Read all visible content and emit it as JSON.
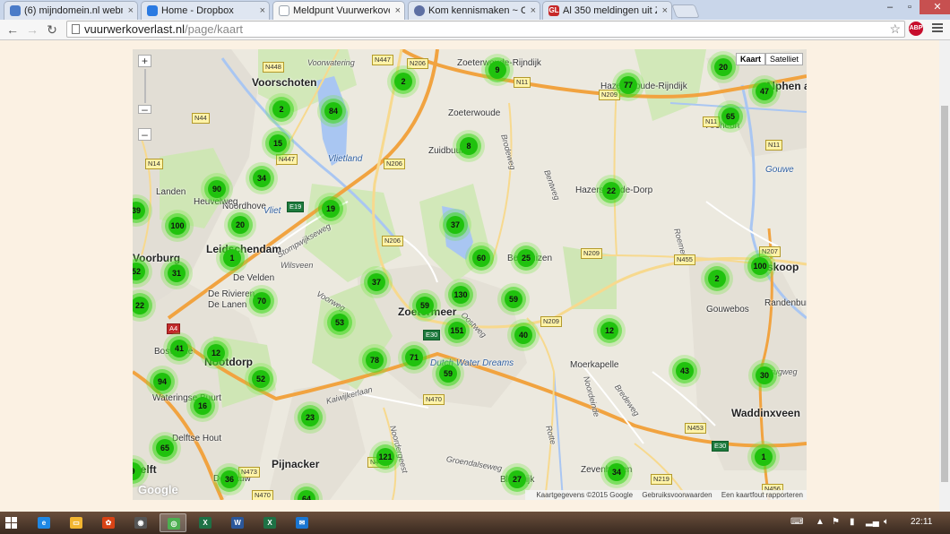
{
  "browser": {
    "tabs": [
      {
        "label": "(6) mijndomein.nl webma",
        "icon": "webmail-icon",
        "color": "#4a7bc8"
      },
      {
        "label": "Home - Dropbox",
        "icon": "dropbox-icon",
        "color": "#2a7ae2"
      },
      {
        "label": "Meldpunt Vuurwerkoverla",
        "icon": "page-icon",
        "color": "#9aa3ad",
        "active": true
      },
      {
        "label": "Kom kennismaken ~ Cont",
        "icon": "globe-icon",
        "color": "#5d6fa3"
      },
      {
        "label": "Al 350 meldingen uit Zoet",
        "icon": "gl-icon",
        "color": "#c62828"
      }
    ],
    "close_label": "×",
    "url_host": "vuurwerkoverlast.nl",
    "url_path": "/page/kaart",
    "abp_label": "ABP",
    "window_controls": [
      "–",
      "▫",
      "✕"
    ]
  },
  "map": {
    "zoom_in": "+",
    "zoom_out": "–",
    "zoom_out2": "–",
    "map_types": [
      "Kaart",
      "Satelliet"
    ],
    "google_logo": "Google",
    "attribution": [
      "Kaartgegevens ©2015 Google",
      "Gebruiksvoorwaarden",
      "Een kaartfout rapporteren"
    ],
    "places": [
      {
        "name": "Voorschoten",
        "big": true
      },
      {
        "name": "Leidschendam",
        "big": true
      },
      {
        "name": "Voorburg",
        "big": true
      },
      {
        "name": "Zoetermeer",
        "big": true
      },
      {
        "name": "Nootdorp",
        "big": true
      },
      {
        "name": "Pijnacker",
        "big": true
      },
      {
        "name": "Delft",
        "big": true
      },
      {
        "name": "Zoeterwoude",
        "big": false
      },
      {
        "name": "Zoeterwoude-Rijndijk",
        "big": false
      },
      {
        "name": "Zuidbuurt",
        "big": false
      },
      {
        "name": "Hazerswoude-Rijndijk",
        "big": false
      },
      {
        "name": "Hazerswoude-Dorp",
        "big": false
      },
      {
        "name": "Benthuizen",
        "big": false
      },
      {
        "name": "Moerkapelle",
        "big": false
      },
      {
        "name": "Waddinxveen",
        "big": true
      },
      {
        "name": "Randenburg",
        "big": false
      },
      {
        "name": "Boskoop",
        "big": true
      },
      {
        "name": "Gouwebos",
        "big": false
      },
      {
        "name": "Alphen aan den Rijn",
        "big": true
      },
      {
        "name": "Archeon",
        "big": false
      },
      {
        "name": "Zevenhuizen",
        "big": false
      },
      {
        "name": "Bleiswijk",
        "big": false
      },
      {
        "name": "Delfgauw",
        "big": false
      },
      {
        "name": "Landen",
        "big": false
      },
      {
        "name": "De Velden",
        "big": false
      },
      {
        "name": "De Rivieren",
        "big": false
      },
      {
        "name": "De Lanen",
        "big": false
      },
      {
        "name": "Bosweide",
        "big": false
      },
      {
        "name": "Wateringse Buurt",
        "big": false
      },
      {
        "name": "Delftse Hout",
        "big": false
      },
      {
        "name": "Noordhove",
        "big": false
      },
      {
        "name": "Heuvelweg",
        "big": false
      }
    ],
    "water_labels": [
      "Vlietland",
      "Vliet",
      "Dutch Water Dreams",
      "Gouwe"
    ],
    "road_labels": [
      "Voorwatering",
      "Stompwijkseweg",
      "Wilsveen",
      "Voorweg",
      "Oostweg",
      "Kaiwijkerlaan",
      "Bentweg",
      "Brodeweg",
      "Noordeinde",
      "Bredeweg",
      "Rotte",
      "Roemer",
      "Brugweg",
      "Groendalseweg",
      "Noordergeest"
    ],
    "road_shields": [
      {
        "label": "N448",
        "kind": "n"
      },
      {
        "label": "N447",
        "kind": "n"
      },
      {
        "label": "N206",
        "kind": "n"
      },
      {
        "label": "N44",
        "kind": "n"
      },
      {
        "label": "N14",
        "kind": "n"
      },
      {
        "label": "N447",
        "kind": "n"
      },
      {
        "label": "E19",
        "kind": "e"
      },
      {
        "label": "N206",
        "kind": "n"
      },
      {
        "label": "N206",
        "kind": "n"
      },
      {
        "label": "N11",
        "kind": "n"
      },
      {
        "label": "N209",
        "kind": "n"
      },
      {
        "label": "N11",
        "kind": "n"
      },
      {
        "label": "N11",
        "kind": "n"
      },
      {
        "label": "N209",
        "kind": "n"
      },
      {
        "label": "N455",
        "kind": "n"
      },
      {
        "label": "N207",
        "kind": "n"
      },
      {
        "label": "N209",
        "kind": "n"
      },
      {
        "label": "A4",
        "kind": "a"
      },
      {
        "label": "E30",
        "kind": "e"
      },
      {
        "label": "N470",
        "kind": "n"
      },
      {
        "label": "N453",
        "kind": "n"
      },
      {
        "label": "E30",
        "kind": "e"
      },
      {
        "label": "N473",
        "kind": "n"
      },
      {
        "label": "N470",
        "kind": "n"
      },
      {
        "label": "N219",
        "kind": "n"
      },
      {
        "label": "N456",
        "kind": "n"
      },
      {
        "label": "N470",
        "kind": "n"
      }
    ],
    "clusters": [
      {
        "count": "9"
      },
      {
        "count": "2"
      },
      {
        "count": "20"
      },
      {
        "count": "47"
      },
      {
        "count": "77"
      },
      {
        "count": "2"
      },
      {
        "count": "84"
      },
      {
        "count": "65"
      },
      {
        "count": "15"
      },
      {
        "count": "8"
      },
      {
        "count": "34"
      },
      {
        "count": "90"
      },
      {
        "count": "22"
      },
      {
        "count": "19"
      },
      {
        "count": "39"
      },
      {
        "count": "100"
      },
      {
        "count": "20"
      },
      {
        "count": "37"
      },
      {
        "count": "1"
      },
      {
        "count": "60"
      },
      {
        "count": "25"
      },
      {
        "count": "100"
      },
      {
        "count": "52"
      },
      {
        "count": "31"
      },
      {
        "count": "2"
      },
      {
        "count": "37"
      },
      {
        "count": "70"
      },
      {
        "count": "130"
      },
      {
        "count": "59"
      },
      {
        "count": "22"
      },
      {
        "count": "59"
      },
      {
        "count": "53"
      },
      {
        "count": "151"
      },
      {
        "count": "40"
      },
      {
        "count": "12"
      },
      {
        "count": "41"
      },
      {
        "count": "12"
      },
      {
        "count": "78"
      },
      {
        "count": "71"
      },
      {
        "count": "59"
      },
      {
        "count": "43"
      },
      {
        "count": "30"
      },
      {
        "count": "94"
      },
      {
        "count": "52"
      },
      {
        "count": "16"
      },
      {
        "count": "23"
      },
      {
        "count": "65"
      },
      {
        "count": "121"
      },
      {
        "count": "1"
      },
      {
        "count": "9"
      },
      {
        "count": "36"
      },
      {
        "count": "27"
      },
      {
        "count": "34"
      },
      {
        "count": "64"
      }
    ]
  },
  "taskbar": {
    "apps": [
      "ie-icon",
      "explorer-icon",
      "paint-icon",
      "camera-icon",
      "chrome-icon",
      "excel-icon",
      "word-icon",
      "excel-icon",
      "mail-icon"
    ],
    "clock": "22:11"
  }
}
